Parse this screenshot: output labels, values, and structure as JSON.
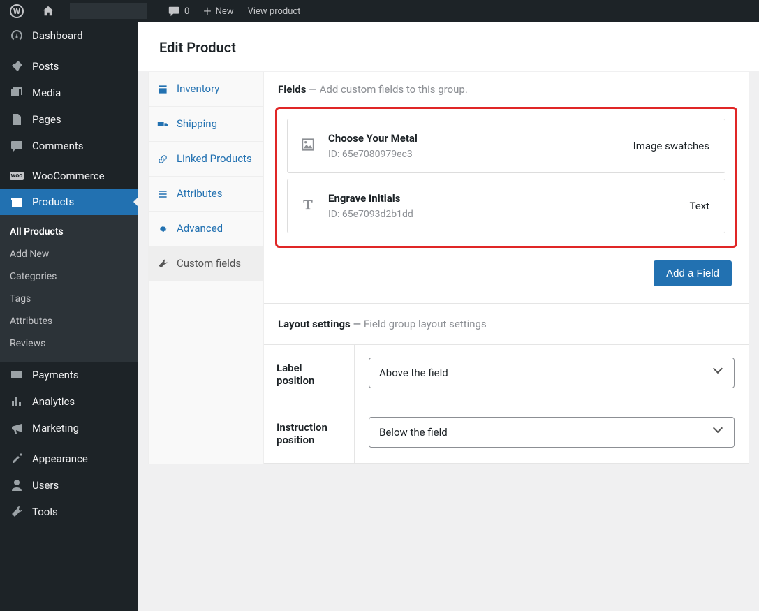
{
  "topbar": {
    "comment_count": "0",
    "new_label": "New",
    "view_product": "View product"
  },
  "sidebar": {
    "dashboard": "Dashboard",
    "posts": "Posts",
    "media": "Media",
    "pages": "Pages",
    "comments": "Comments",
    "woocommerce": "WooCommerce",
    "products": "Products",
    "payments": "Payments",
    "analytics": "Analytics",
    "marketing": "Marketing",
    "appearance": "Appearance",
    "users": "Users",
    "tools": "Tools",
    "submenu": {
      "all_products": "All Products",
      "add_new": "Add New",
      "categories": "Categories",
      "tags": "Tags",
      "attributes": "Attributes",
      "reviews": "Reviews"
    }
  },
  "page_title": "Edit Product",
  "tabs": {
    "inventory": "Inventory",
    "shipping": "Shipping",
    "linked_products": "Linked Products",
    "attributes": "Attributes",
    "advanced": "Advanced",
    "custom_fields": "Custom fields"
  },
  "fields": {
    "heading": "Fields",
    "sub": "Add custom fields to this group.",
    "items": [
      {
        "title": "Choose Your Metal",
        "id": "ID: 65e7080979ec3",
        "type": "Image swatches"
      },
      {
        "title": "Engrave Initials",
        "id": "ID: 65e7093d2b1dd",
        "type": "Text"
      }
    ],
    "add_button": "Add a Field"
  },
  "layout": {
    "heading": "Layout settings",
    "sub": "Field group layout settings",
    "label_position_label": "Label position",
    "label_position_value": "Above the field",
    "instruction_position_label": "Instruction position",
    "instruction_position_value": "Below the field"
  }
}
